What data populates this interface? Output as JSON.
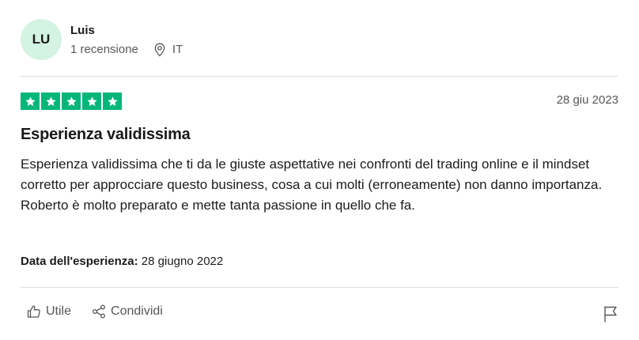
{
  "reviewer": {
    "initials": "LU",
    "name": "Luis",
    "review_count": "1 recensione",
    "country": "IT"
  },
  "review": {
    "rating": 5,
    "date": "28 giu 2023",
    "title": "Esperienza validissima",
    "body": [
      "Esperienza validissima che ti da le giuste aspettative nei confronti del trading online e il mindset corretto per approcciare questo business, cosa a cui molti (erroneamente) non danno importanza.",
      "Roberto è molto preparato e mette tanta passione in quello che fa."
    ],
    "experience_label": "Data dell'esperienza:",
    "experience_date": "28 giugno 2022"
  },
  "actions": {
    "useful_label": "Utile",
    "share_label": "Condividi"
  },
  "colors": {
    "star_bg": "#00b67a",
    "avatar_bg": "#d4f3e2"
  },
  "icons": {
    "location": "location-pin-icon",
    "useful": "thumbs-up-icon",
    "share": "share-icon",
    "report": "flag-icon",
    "star": "star-icon"
  }
}
